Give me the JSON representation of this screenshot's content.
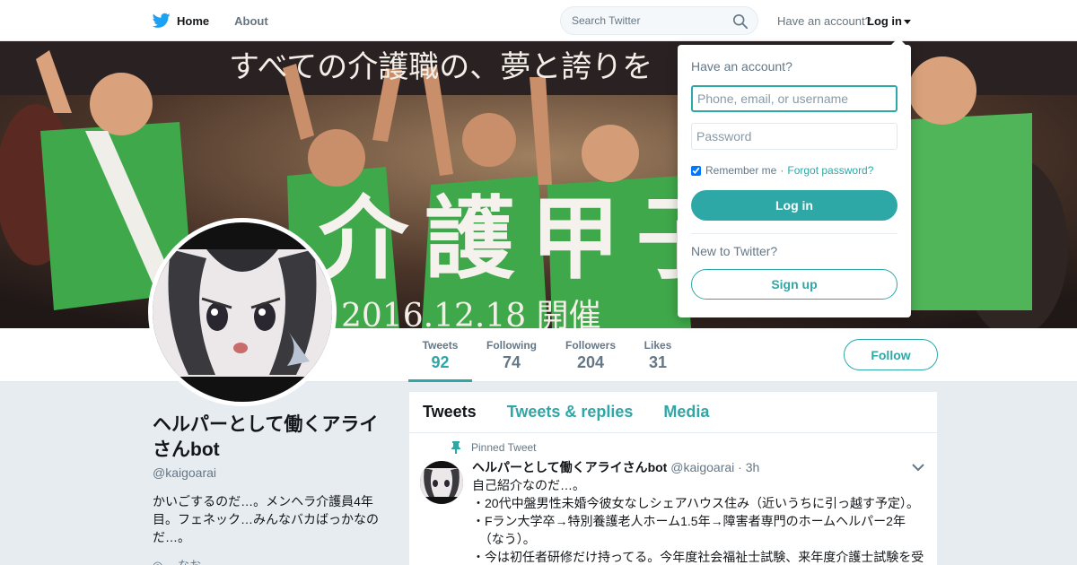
{
  "nav": {
    "home": "Home",
    "about": "About",
    "search_placeholder": "Search Twitter",
    "account_prompt": "Have an account?",
    "login": "Log in"
  },
  "banner": {
    "top_text": "すべての介護職の、夢と誇りを",
    "center_text": "介護甲子",
    "date_text": "2016.12.18 開催"
  },
  "profile": {
    "name": "ヘルパーとして働くアライさんbot",
    "screen_name": "@kaigoarai",
    "bio": "かいごするのだ…。メンヘラ介護員4年目。フェネック…みんなバカばっかなのだ…。",
    "location": "◎ …なお"
  },
  "stats": [
    {
      "label": "Tweets",
      "value": "92"
    },
    {
      "label": "Following",
      "value": "74"
    },
    {
      "label": "Followers",
      "value": "204"
    },
    {
      "label": "Likes",
      "value": "31"
    }
  ],
  "follow_label": "Follow",
  "timeline": {
    "tabs": [
      "Tweets",
      "Tweets & replies",
      "Media"
    ],
    "pinned_label": "Pinned Tweet",
    "tweet": {
      "fullname": "ヘルパーとして働くアライさんbot",
      "handle": "@kaigoarai",
      "time": "· 3h",
      "text": "自己紹介なのだ…。\n・20代中盤男性未婚今彼女なしシェアハウス住み（近いうちに引っ越す予定）。\n・Fラン大学卒→特別養護老人ホーム1.5年→障害者専門のホームヘルパー2年\n  （なう）。\n・今は初任者研修だけ持ってる。今年度社会福祉士試験、来年度介護士試験を受"
    }
  },
  "login_dropdown": {
    "title": "Have an account?",
    "username_placeholder": "Phone, email, or username",
    "password_placeholder": "Password",
    "remember": "Remember me",
    "separator": "·",
    "forgot": "Forgot password?",
    "login_button": "Log in",
    "new_prompt": "New to Twitter?",
    "signup_button": "Sign up"
  },
  "colors": {
    "accent": "#2ea7a7",
    "background": "#e6ecf0"
  }
}
